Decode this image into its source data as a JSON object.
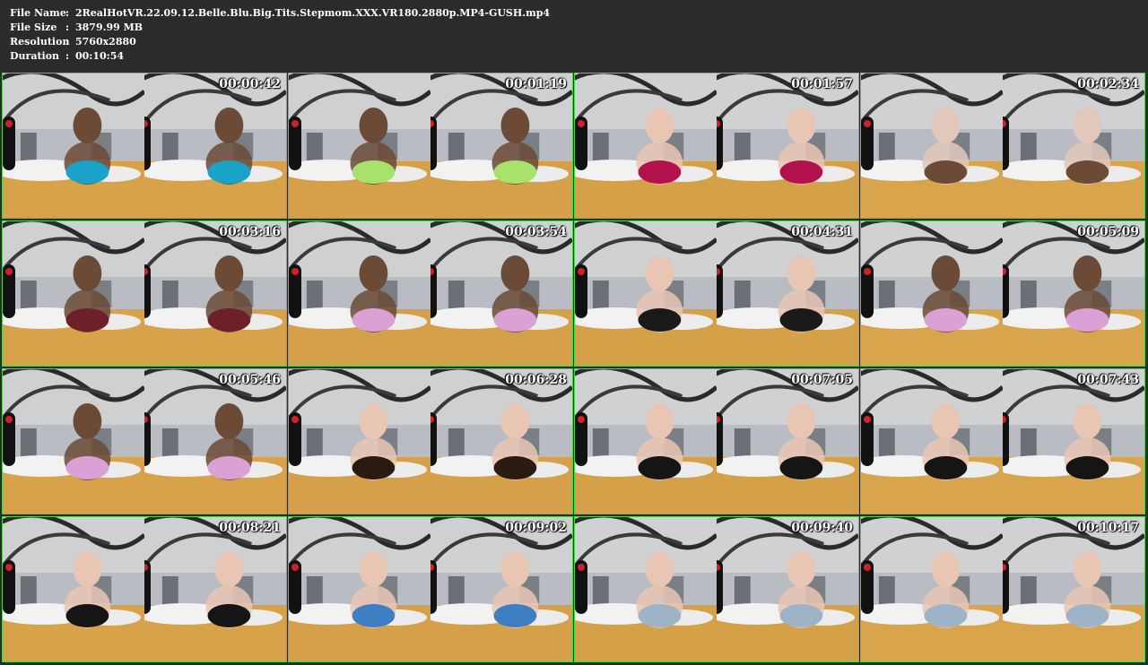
{
  "file_info": [
    {
      "label": "File Name",
      "value": "2RealHotVR.22.09.12.Belle.Blu.Big.Tits.Stepmom.XXX.VR180.2880p.MP4-GUSH.mp4"
    },
    {
      "label": "File Size",
      "value": "3879.99 MB"
    },
    {
      "label": "Resolution",
      "value": "5760x2880"
    },
    {
      "label": "Duration",
      "value": "00:10:54"
    }
  ],
  "separator": ":",
  "thumbnails": [
    {
      "time": "00:00:42",
      "top": "#cfd0d2",
      "floor": "#d7a24a",
      "accent": "#1aa3c9",
      "figure": "#6b4a36"
    },
    {
      "time": "00:01:19",
      "top": "#cfd0d2",
      "floor": "#d6a04a",
      "accent": "#a7e36b",
      "figure": "#6b4a36"
    },
    {
      "time": "00:01:57",
      "top": "#d0d1d3",
      "floor": "#d4a048",
      "accent": "#b1124d",
      "figure": "#e9c5b4"
    },
    {
      "time": "00:02:34",
      "top": "#d0d1d3",
      "floor": "#d9a54c",
      "accent": "#6b4a36",
      "figure": "#e2c8bb"
    },
    {
      "time": "00:03:16",
      "top": "#cfd0d2",
      "floor": "#d7a24a",
      "accent": "#6e1f2a",
      "figure": "#6b4a36"
    },
    {
      "time": "00:03:54",
      "top": "#cfd0d2",
      "floor": "#d6a04a",
      "accent": "#d9a1d6",
      "figure": "#6b4a36"
    },
    {
      "time": "00:04:31",
      "top": "#d0d1d3",
      "floor": "#d4a048",
      "accent": "#1a1a1a",
      "figure": "#e9c5b4"
    },
    {
      "time": "00:05:09",
      "top": "#d0d1d3",
      "floor": "#d9a54c",
      "accent": "#d9a1d6",
      "figure": "#6b4a36"
    },
    {
      "time": "00:05:46",
      "top": "#cfd0d2",
      "floor": "#d7a24a",
      "accent": "#d9a1d6",
      "figure": "#6b4a36"
    },
    {
      "time": "00:06:28",
      "top": "#cfd0d2",
      "floor": "#d6a04a",
      "accent": "#2a1a12",
      "figure": "#e9c5b4"
    },
    {
      "time": "00:07:05",
      "top": "#d0d1d3",
      "floor": "#d4a048",
      "accent": "#151515",
      "figure": "#e9c5b4"
    },
    {
      "time": "00:07:43",
      "top": "#d0d1d3",
      "floor": "#d9a54c",
      "accent": "#151515",
      "figure": "#e9c5b4"
    },
    {
      "time": "00:08:21",
      "top": "#cfd0d2",
      "floor": "#d7a24a",
      "accent": "#151515",
      "figure": "#e9c5b4"
    },
    {
      "time": "00:09:02",
      "top": "#cfd0d2",
      "floor": "#d6a04a",
      "accent": "#3e7fc4",
      "figure": "#e9c5b4"
    },
    {
      "time": "00:09:40",
      "top": "#d0d1d3",
      "floor": "#d4a048",
      "accent": "#9fb3c6",
      "figure": "#e9c5b4"
    },
    {
      "time": "00:10:17",
      "top": "#d0d1d3",
      "floor": "#d9a54c",
      "accent": "#9fb3c6",
      "figure": "#e9c5b4"
    }
  ],
  "colors": {
    "background": "#2b2b2b",
    "tile_border": "#4bd24b",
    "text": "#ffffff"
  }
}
